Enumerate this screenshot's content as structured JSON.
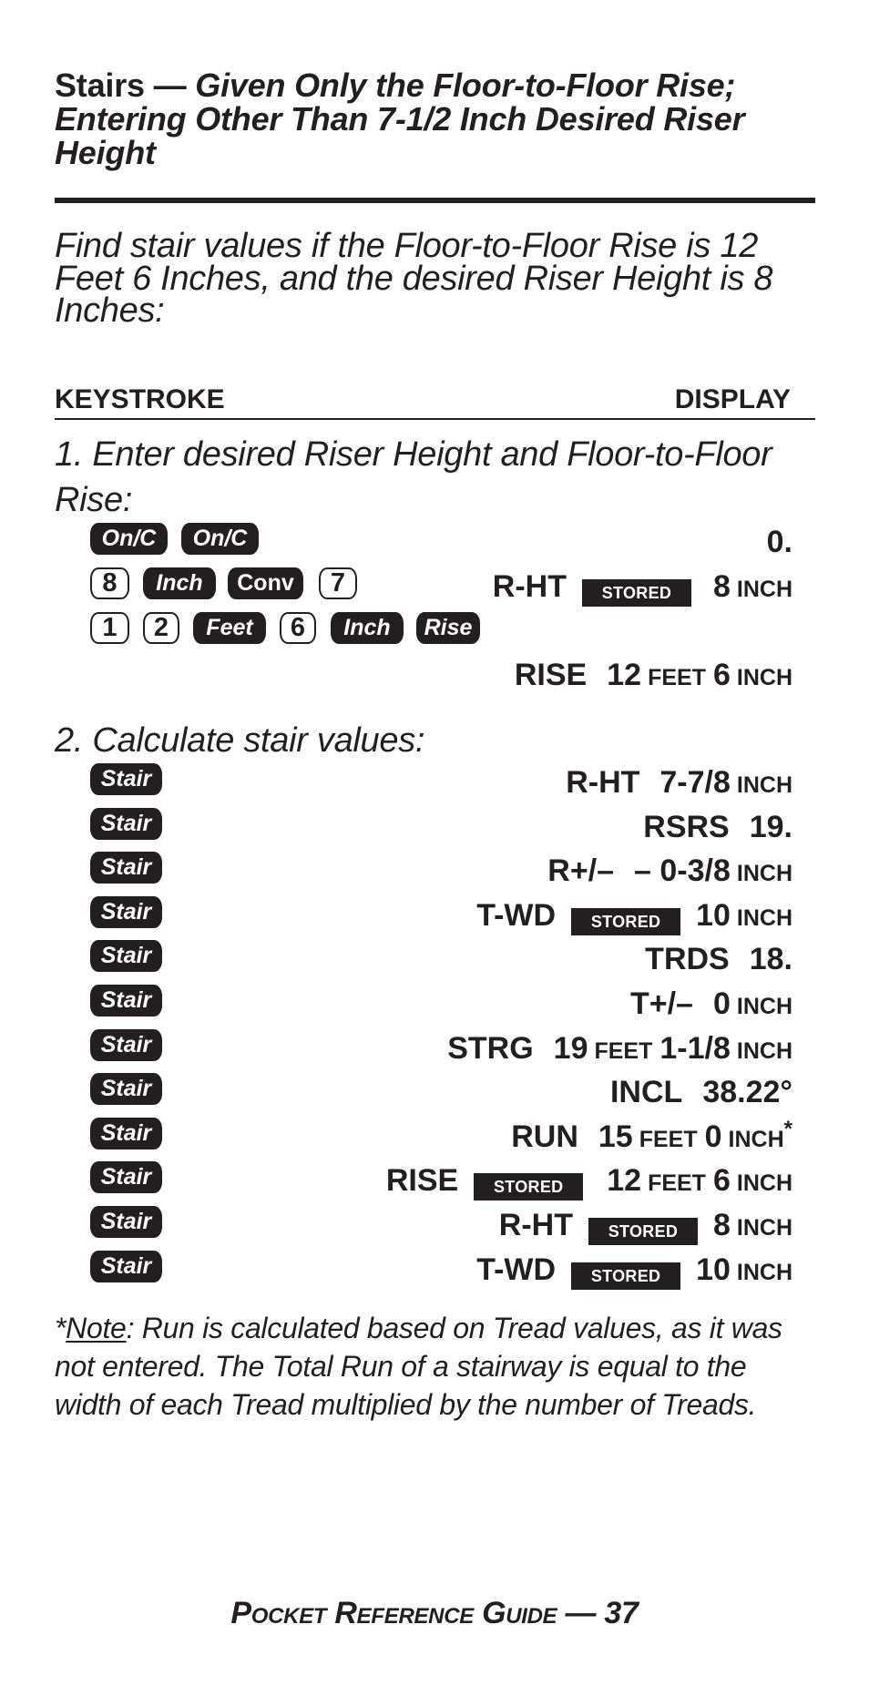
{
  "title": {
    "prefix": "Stairs — ",
    "italic": "Given Only the Floor-to-Floor Rise; Entering Other Than 7-1/2 Inch Desired Riser Height"
  },
  "intro": "Find stair values if the Floor-to-Floor Rise is 12 Feet 6 Inches, and the desired Riser Height is 8 Inches:",
  "columns": {
    "keystroke": "KEYSTROKE",
    "display": "DISPLAY"
  },
  "step1": {
    "label": "1. Enter desired Riser Height and Floor-to-Floor Rise:",
    "rows": [
      {
        "keys": [
          "On/C",
          "On/C"
        ],
        "display": {
          "value": "0."
        }
      },
      {
        "keys": [
          "8",
          "Inch",
          "Conv",
          "7"
        ],
        "display": {
          "label": "R-HT",
          "stored": "STORED",
          "value": "8",
          "unit": "INCH"
        }
      },
      {
        "keys": [
          "1",
          "2",
          "Feet",
          "6",
          "Inch",
          "Rise"
        ]
      },
      {
        "display": {
          "label": "RISE",
          "value": "12",
          "unit": "FEET",
          "value2": "6",
          "unit2": "INCH"
        }
      }
    ]
  },
  "step2": {
    "label": "2. Calculate stair values:",
    "key": "Stair",
    "rows": [
      {
        "label": "R-HT",
        "value": "7-7/8",
        "unit": "INCH"
      },
      {
        "label": "RSRS",
        "value": "19."
      },
      {
        "label": "R+/–",
        "value": "– 0-3/8",
        "unit": "INCH"
      },
      {
        "label": "T-WD",
        "stored": "STORED",
        "value": "10",
        "unit": "INCH"
      },
      {
        "label": "TRDS",
        "value": "18."
      },
      {
        "label": "T+/–",
        "value": "0",
        "unit": "INCH"
      },
      {
        "label": "STRG",
        "value": "19",
        "unit": "FEET",
        "value2": "1-1/8",
        "unit2": "INCH"
      },
      {
        "label": "INCL",
        "value": "38.22°"
      },
      {
        "label": "RUN",
        "value": "15",
        "unit": "FEET",
        "value2": "0",
        "unit2": "INCH",
        "mark": "*"
      },
      {
        "label": "RISE",
        "stored": "STORED",
        "value": "12",
        "unit": "FEET",
        "value2": "6",
        "unit2": "INCH"
      },
      {
        "label": "R-HT",
        "stored": "STORED",
        "value": "8",
        "unit": "INCH"
      },
      {
        "label": "T-WD",
        "stored": "STORED",
        "value": "10",
        "unit": "INCH"
      }
    ]
  },
  "note": {
    "asterisk": "*",
    "label": "Note",
    "text": ": Run is calculated based on Tread values, as it was not entered. The Total Run of a stairway is equal to the width of each Tread multiplied by the number of Treads."
  },
  "footer": "Pocket Reference Guide — 37"
}
